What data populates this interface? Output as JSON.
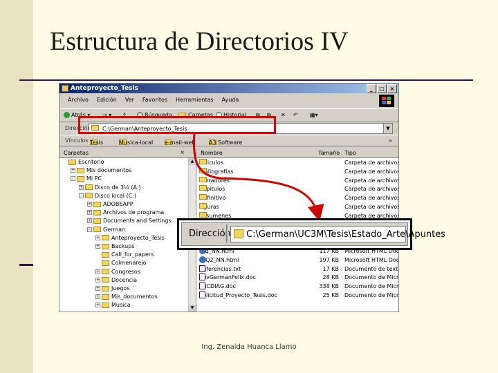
{
  "slide": {
    "title": "Estructura de Directorios IV",
    "footer": "Ing. Zenaida Huanca Llamo"
  },
  "colors": {
    "background": "#fffce6",
    "accent_bar": "#e9e3c1",
    "rule": "#36104a",
    "highlight": "#e30000",
    "arrow": "#d20000"
  },
  "window": {
    "title": "Anteproyecto_Tesis",
    "buttons": [
      "_",
      "□",
      "×"
    ],
    "menu": [
      "Archivo",
      "Edición",
      "Ver",
      "Favoritos",
      "Herramientas",
      "Ayuda"
    ],
    "toolbar": {
      "back": "Atrás",
      "search": "Búsqueda",
      "folders": "Carpetas",
      "history": "Historial"
    },
    "address": {
      "label": "Dirección",
      "value": "C:\\German\\Anteproyecto_Tesis"
    },
    "links": {
      "label": "Vínculos",
      "items": [
        "Tesis",
        "Musica-local",
        "e-mail-web",
        "A3 Software"
      ],
      "more": "»"
    },
    "folders_pane": {
      "title": "Carpetas",
      "close": "×"
    },
    "tree": [
      {
        "label": "Escritorio",
        "pm": ""
      },
      {
        "label": "Mis documentos",
        "pm": "+"
      },
      {
        "label": "Mi PC",
        "pm": "-"
      },
      {
        "label": "Disco de 3½ (A:)",
        "pm": "+"
      },
      {
        "label": "Disco local (C:)",
        "pm": "-"
      },
      {
        "label": "ADOBEAPP",
        "pm": "+"
      },
      {
        "label": "Archivos de programa",
        "pm": "+"
      },
      {
        "label": "Documents and Settings",
        "pm": "+"
      },
      {
        "label": "German",
        "pm": "-"
      },
      {
        "label": "Anteproyecto_Tesis",
        "pm": "+"
      },
      {
        "label": "Backups",
        "pm": "+"
      },
      {
        "label": "Call_for_papers",
        "pm": ""
      },
      {
        "label": "Colmenarejo",
        "pm": ""
      },
      {
        "label": "Congresos",
        "pm": "+"
      },
      {
        "label": "Docencia",
        "pm": "+"
      },
      {
        "label": "Juegos",
        "pm": "+"
      },
      {
        "label": "Mis_documentos",
        "pm": "+"
      },
      {
        "label": "Musica",
        "pm": "+"
      }
    ],
    "columns": {
      "name": "Nombre",
      "size": "Tamaño",
      "type": "Tipo"
    },
    "files": [
      {
        "name": "Articulos",
        "size": "",
        "type": "Carpeta de archivos",
        "icon": "folder"
      },
      {
        "name": "Bibliografias",
        "size": "",
        "type": "Carpeta de archivos",
        "icon": "folder"
      },
      {
        "name": "Borradores",
        "size": "",
        "type": "Carpeta de archivos",
        "icon": "folder"
      },
      {
        "name": "Capitulos",
        "size": "",
        "type": "Carpeta de archivos",
        "icon": "folder"
      },
      {
        "name": "Definitivo",
        "size": "",
        "type": "Carpeta de archivos",
        "icon": "folder"
      },
      {
        "name": "Figuras",
        "size": "",
        "type": "Carpeta de archivos",
        "icon": "folder"
      },
      {
        "name": "Resumenes",
        "size": "",
        "type": "Carpeta de archivos",
        "icon": "folder"
      },
      {
        "name": "",
        "size": "",
        "type": "",
        "icon": "folder"
      },
      {
        "name": "",
        "size": "",
        "type": "",
        "icon": "folder"
      },
      {
        "name": "Chris_Sturgeon_NN_article1.html",
        "size": "16 KB",
        "type": "Microsoft HTML Doc",
        "icon": "html"
      },
      {
        "name": "Faq_NN.html",
        "size": "117 KB",
        "type": "Microsoft HTML Doc",
        "icon": "html"
      },
      {
        "name": "FAQ2_NN.html",
        "size": "197 KB",
        "type": "Microsoft HTML Doc",
        "icon": "html"
      },
      {
        "name": "Referencias.txt",
        "size": "17 KB",
        "type": "Documento de texto",
        "icon": "doc"
      },
      {
        "name": "RevGermanFelix.doc",
        "size": "28 KB",
        "type": "Documento de Micr...",
        "icon": "doc"
      },
      {
        "name": "SBCDIAG.doc",
        "size": "338 KB",
        "type": "Documento de Micr...",
        "icon": "doc"
      },
      {
        "name": "Solicitud_Proyecto_Tesis.doc",
        "size": "25 KB",
        "type": "Documento de Micr...",
        "icon": "doc"
      }
    ]
  },
  "zoom_callout": {
    "label": "Dirección",
    "value": "C:\\German\\UC3M\\Tesis\\Estado_Arte\\Apuntes"
  }
}
